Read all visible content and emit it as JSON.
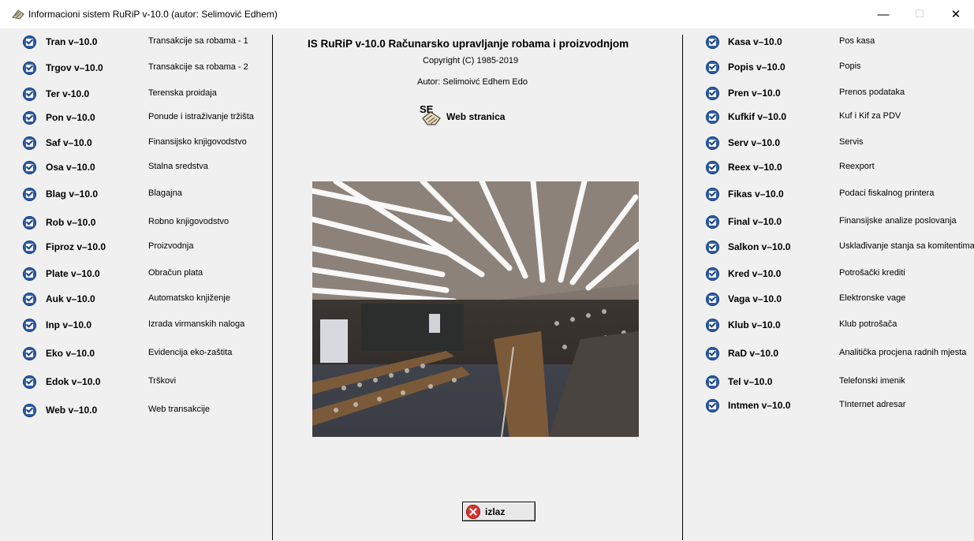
{
  "window": {
    "title": "Informacioni sistem RuRiP v-10.0 (autor: Selimović Edhem)",
    "minimize_symbol": "—",
    "maximize_symbol": "☐",
    "close_symbol": "✕"
  },
  "header": {
    "title": "IS RuRiP v-10.0  Računarsko upravljanje robama i proizvodnjom",
    "copyright": "Copyright (C) 1985-2019",
    "author": "Autor: Selimoivć Edhem Edo",
    "web_link_label": "Web stranica",
    "web_icon_text": "SE"
  },
  "left_modules": [
    {
      "name": "Tran v–10.0",
      "desc": "Transakcije sa robama - 1"
    },
    {
      "name": "Trgov v–10.0",
      "desc": "Transakcije sa robama - 2"
    },
    {
      "name": "Ter v-10.0",
      "desc": "Terenska proidaja"
    },
    {
      "name": "Pon v–10.0",
      "desc": "Ponude i istraživanje tržišta"
    },
    {
      "name": "Saf v–10.0",
      "desc": "Finansijsko knjigovodstvo"
    },
    {
      "name": "Osa v–10.0",
      "desc": "Stalna sredstva"
    },
    {
      "name": "Blag v–10.0",
      "desc": "Blagajna"
    },
    {
      "name": "Rob v–10.0",
      "desc": "Robno knjigovodstvo"
    },
    {
      "name": "Fiproz v–10.0",
      "desc": "Proizvodnja"
    },
    {
      "name": "Plate v–10.0",
      "desc": "Obračun plata"
    },
    {
      "name": "Auk v–10.0",
      "desc": "Automatsko knjiženje"
    },
    {
      "name": "Inp v–10.0",
      "desc": "Izrada virmanskih naloga"
    },
    {
      "name": "Eko v–10.0",
      "desc": "Evidencija eko-zaštita"
    },
    {
      "name": "Edok v–10.0",
      "desc": "Trškovi"
    },
    {
      "name": "Web v–10.0",
      "desc": "Web transakcije"
    }
  ],
  "right_modules": [
    {
      "name": "Kasa v–10.0",
      "desc": "Pos kasa"
    },
    {
      "name": "Popis v–10.0",
      "desc": "Popis"
    },
    {
      "name": "Pren v–10.0",
      "desc": "Prenos podataka"
    },
    {
      "name": "Kufkif v–10.0",
      "desc": "Kuf i Kif za PDV"
    },
    {
      "name": "Serv v–10.0",
      "desc": "Servis"
    },
    {
      "name": "Reex v–10.0",
      "desc": "Reexport"
    },
    {
      "name": "Fikas v–10.0",
      "desc": "Podaci fiskalnog printera"
    },
    {
      "name": "Final v–10.0",
      "desc": "Finansijske analize poslovanja"
    },
    {
      "name": "Salkon v–10.0",
      "desc": "Usklađivanje stanja sa komitentima"
    },
    {
      "name": "Kred v–10.0",
      "desc": "Potrošački krediti"
    },
    {
      "name": "Vaga v–10.0",
      "desc": "Elektronske vage"
    },
    {
      "name": "Klub  v–10.0",
      "desc": "Klub potrošača"
    },
    {
      "name": "RaD  v–10.0",
      "desc": "Analitička procjena radnih mjesta"
    },
    {
      "name": "Tel  v–10.0",
      "desc": "Telefonski imenik"
    },
    {
      "name": "Intmen v–10.0",
      "desc": "TInternet adresar"
    }
  ],
  "exit_button": {
    "label": "izlaz"
  },
  "colors": {
    "checkbox": "#2c5fa8",
    "exit_icon": "#d9342b",
    "background": "#f0f0f0"
  }
}
